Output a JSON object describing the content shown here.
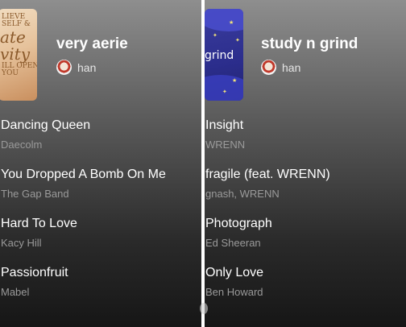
{
  "left_playlist": {
    "cover_lines": [
      "LIEVE",
      "SELF &",
      "ate",
      "vity",
      "ILL OPEN",
      "YOU"
    ],
    "title": "very aerie",
    "owner": "han",
    "tracks": [
      {
        "title": "Dancing Queen",
        "artist": "Daecolm"
      },
      {
        "title": "You Dropped A Bomb On Me",
        "artist": "The Gap Band"
      },
      {
        "title": "Hard To Love",
        "artist": "Kacy Hill"
      },
      {
        "title": "Passionfruit",
        "artist": "Mabel"
      }
    ]
  },
  "right_playlist": {
    "cover_text": "grind",
    "title": "study n grind",
    "owner": "han",
    "tracks": [
      {
        "title": "Insight",
        "artist": "WRENN"
      },
      {
        "title": "fragile (feat. WRENN)",
        "artist": "gnash, WRENN"
      },
      {
        "title": "Photograph",
        "artist": "Ed Sheeran"
      },
      {
        "title": "Only Love",
        "artist": "Ben Howard"
      }
    ]
  },
  "colors": {
    "text_primary": "#ffffff",
    "text_secondary": "#9a9a9a",
    "divider": "#ffffff"
  }
}
